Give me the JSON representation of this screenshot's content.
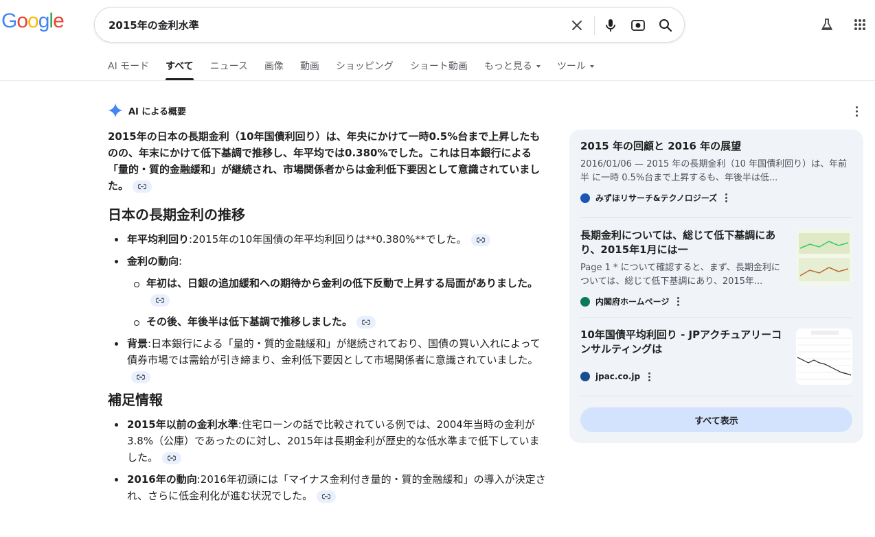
{
  "logo": {
    "letters": [
      "G",
      "o",
      "o",
      "g",
      "l",
      "e"
    ],
    "colors": [
      "#4285f4",
      "#ea4335",
      "#fbbc05",
      "#4285f4",
      "#34a853",
      "#ea4335"
    ]
  },
  "search": {
    "query": "2015年の金利水準"
  },
  "tabs": [
    {
      "label": "AI モード",
      "active": false
    },
    {
      "label": "すべて",
      "active": true
    },
    {
      "label": "ニュース",
      "active": false
    },
    {
      "label": "画像",
      "active": false
    },
    {
      "label": "動画",
      "active": false
    },
    {
      "label": "ショッピング",
      "active": false
    },
    {
      "label": "ショート動画",
      "active": false
    },
    {
      "label": "もっと見る",
      "active": false,
      "dropdown": true
    },
    {
      "label": "ツール",
      "active": false,
      "dropdown": true
    }
  ],
  "ai": {
    "heading": "AI による概要",
    "intro": "2015年の日本の長期金利（10年国債利回り）は、年央にかけて一時0.5%台まで上昇したものの、年末にかけて低下基調で推移し、年平均では0.380%でした。これは日本銀行による「量的・質的金融緩和」が継続され、市場関係者からは金利低下要因として意識されていました。",
    "section1": {
      "title": "日本の長期金利の推移",
      "items": [
        {
          "label": "年平均利回り",
          "text": ":2015年の10年国債の年平均利回りは**0.380%**でした。"
        },
        {
          "label": "金利の動向",
          "text": ":"
        },
        {
          "sub1": "年初は、日銀の追加緩和への期待から金利の低下反動で上昇する局面がありました。"
        },
        {
          "sub2": "その後、年後半は低下基調で推移しました。"
        },
        {
          "label": "背景",
          "text": ":日本銀行による「量的・質的金融緩和」が継続されており、国債の買い入れによって債券市場では需給が引き締まり、金利低下要因として市場関係者に意識されていました。"
        }
      ]
    },
    "section2": {
      "title": "補足情報",
      "items": [
        {
          "label": "2015年以前の金利水準",
          "text": ":住宅ローンの話で比較されている例では、2004年当時の金利が3.8%（公庫）であったのに対し、2015年は長期金利が歴史的な低水準まで低下していました。"
        },
        {
          "label": "2016年の動向",
          "text": ":2016年初頭には「マイナス金利付き量的・質的金融緩和」の導入が決定され、さらに低金利化が進む状況でした。"
        }
      ]
    }
  },
  "sources": [
    {
      "title": "2015 年の回顧と 2016 年の展望",
      "snippet": "2016/01/06 — 2015 年の長期金利（10 年国債利回り）は、年前半 に一時 0.5%台まで上昇するも、年後半は低...",
      "site": "みずほリサーチ&テクノロジーズ"
    },
    {
      "title": "長期金利については、総じて低下基調にあり、2015年1月には一",
      "snippet": "Page 1 * について確認すると、まず、長期金利については、総じて低下基調にあり、2015年...",
      "site": "内閣府ホームページ"
    },
    {
      "title": "10年国債平均利回り - JPアクチュアリーコンサルティングは",
      "snippet": "",
      "site": "jpac.co.jp"
    }
  ],
  "show_all": "すべて表示"
}
